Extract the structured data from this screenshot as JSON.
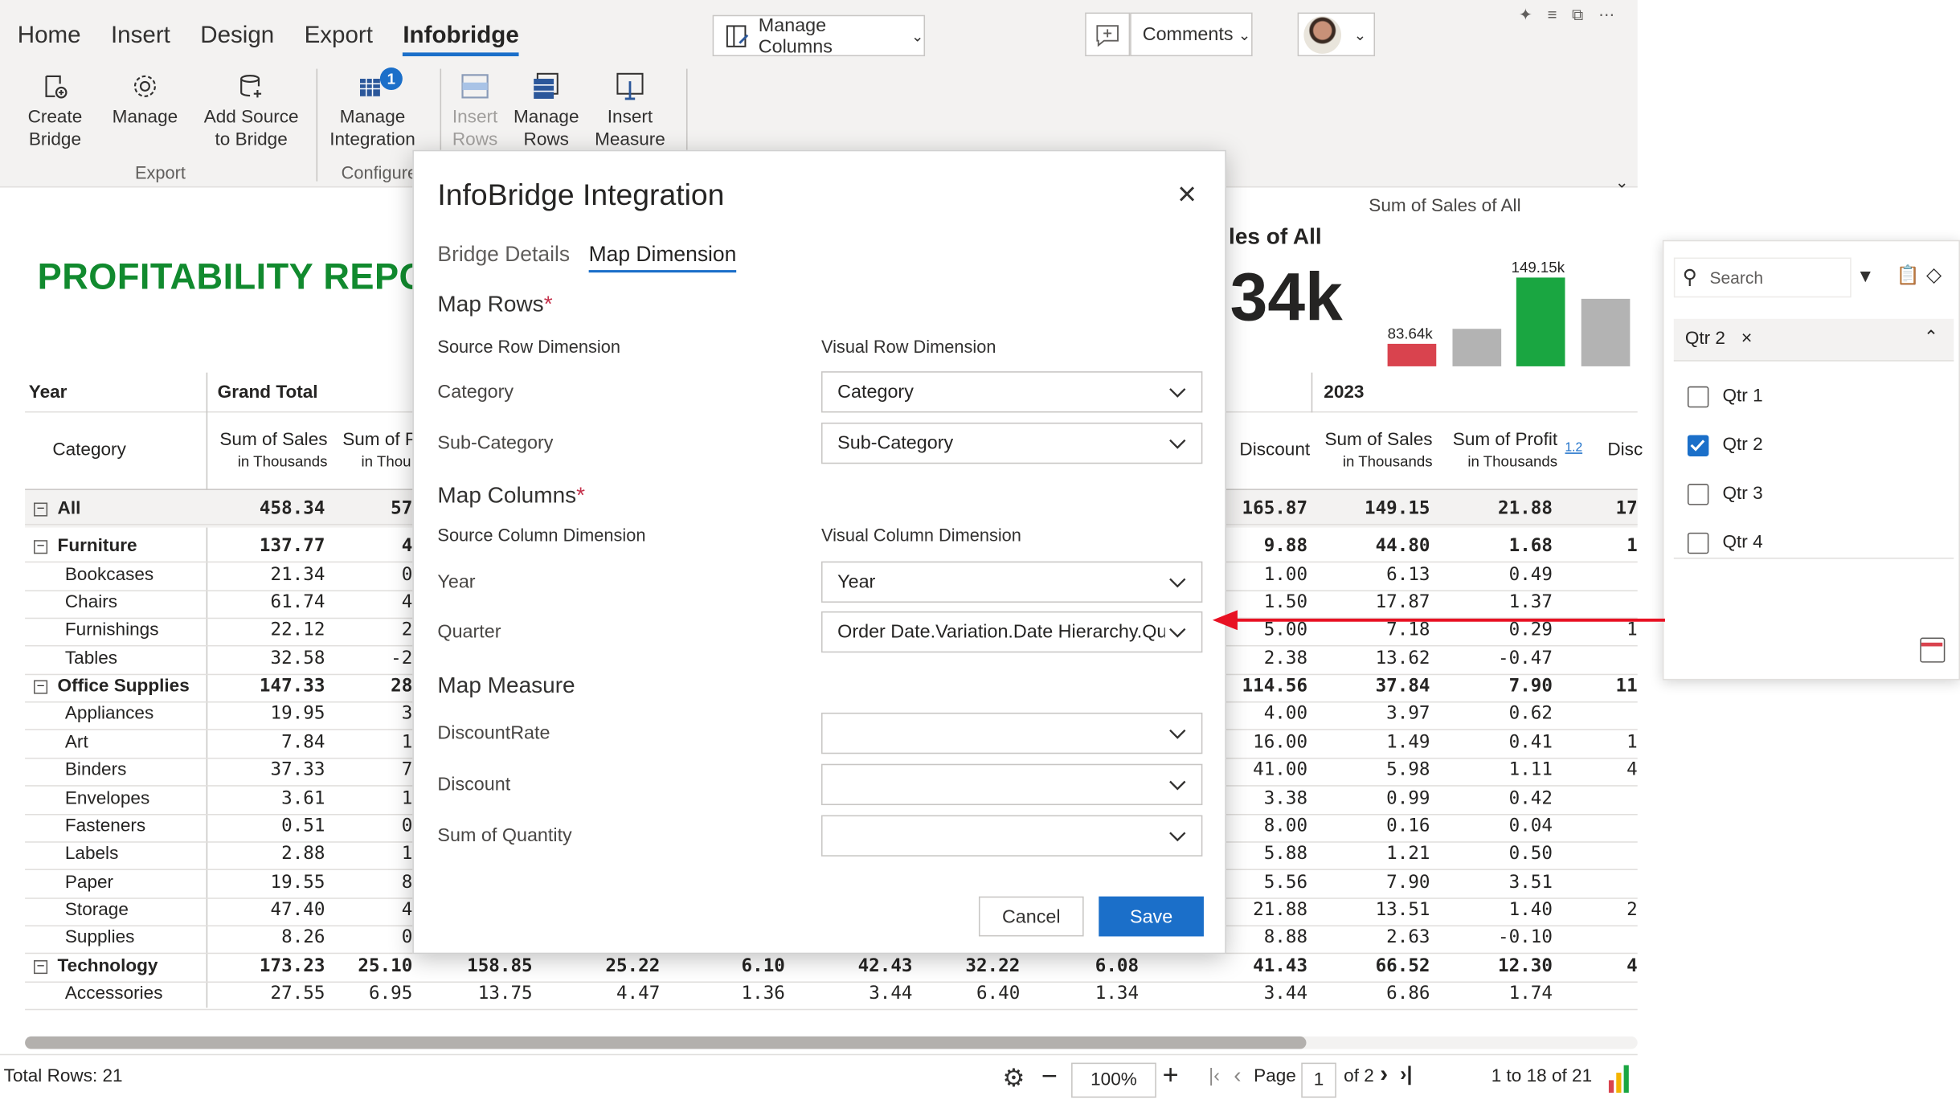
{
  "ribbon": {
    "tabs": [
      "Home",
      "Insert",
      "Design",
      "Export",
      "Infobridge"
    ],
    "buttons": {
      "create_bridge": [
        "Create",
        "Bridge"
      ],
      "manage": "Manage",
      "add_source": [
        "Add Source",
        "to Bridge"
      ],
      "manage_integration": [
        "Manage",
        "Integration"
      ],
      "manage_integration_badge": "1",
      "insert_rows": [
        "Insert",
        "Rows"
      ],
      "manage_rows": [
        "Manage",
        "Rows"
      ],
      "insert_measure": [
        "Insert",
        "Measure"
      ]
    },
    "groups": {
      "export": "Export",
      "configure": "Configure"
    },
    "manage_columns": "Manage Columns",
    "comments": "Comments"
  },
  "report": {
    "title": "PROFITABILITY REPORT",
    "kpi_caption": "Sum of Sales of All",
    "kpi_subtitle": "les of All",
    "kpi_value": "34k",
    "kpi_bar_labels": [
      "83.64k",
      "149.15k"
    ]
  },
  "table": {
    "year_header": "Year",
    "grand_total_header": "Grand Total",
    "year_2023": "2023",
    "category_header": "Category",
    "col_sum_sales": "Sum of Sales",
    "col_in_thousands": "in Thousands",
    "col_sum_profit": "Sum of Profit",
    "col_sum_p_trunc": "Sum of P",
    "col_in_thou_trunc": "in Thou",
    "col_discount": "Discount",
    "col_disc_trunc": "Disc",
    "col_badge": "1.2",
    "rows": [
      {
        "label": "All",
        "bold": true,
        "expand": true,
        "gt_sales": "458.34",
        "gt_p": "57",
        "disc": "165.87",
        "s23": "149.15",
        "p23": "21.88",
        "d23": "17"
      },
      {
        "label": "Furniture",
        "bold": true,
        "expand": true,
        "gt_sales": "137.77",
        "gt_p": "4",
        "disc": "9.88",
        "s23": "44.80",
        "p23": "1.68",
        "d23": "1"
      },
      {
        "label": "Bookcases",
        "gt_sales": "21.34",
        "gt_p": "0",
        "disc": "1.00",
        "s23": "6.13",
        "p23": "0.49",
        "d23": ""
      },
      {
        "label": "Chairs",
        "gt_sales": "61.74",
        "gt_p": "4",
        "disc": "1.50",
        "s23": "17.87",
        "p23": "1.37",
        "d23": ""
      },
      {
        "label": "Furnishings",
        "gt_sales": "22.12",
        "gt_p": "2",
        "disc": "5.00",
        "s23": "7.18",
        "p23": "0.29",
        "d23": "1"
      },
      {
        "label": "Tables",
        "gt_sales": "32.58",
        "gt_p": "-2",
        "disc": "2.38",
        "s23": "13.62",
        "p23": "-0.47",
        "d23": ""
      },
      {
        "label": "Office Supplies",
        "bold": true,
        "expand": true,
        "gt_sales": "147.33",
        "gt_p": "28",
        "disc": "114.56",
        "s23": "37.84",
        "p23": "7.90",
        "d23": "11"
      },
      {
        "label": "Appliances",
        "gt_sales": "19.95",
        "gt_p": "3",
        "disc": "4.00",
        "s23": "3.97",
        "p23": "0.62",
        "d23": ""
      },
      {
        "label": "Art",
        "gt_sales": "7.84",
        "gt_p": "1",
        "disc": "16.00",
        "s23": "1.49",
        "p23": "0.41",
        "d23": "1"
      },
      {
        "label": "Binders",
        "gt_sales": "37.33",
        "gt_p": "7",
        "disc": "41.00",
        "s23": "5.98",
        "p23": "1.11",
        "d23": "4"
      },
      {
        "label": "Envelopes",
        "gt_sales": "3.61",
        "gt_p": "1",
        "disc": "3.38",
        "s23": "0.99",
        "p23": "0.42",
        "d23": ""
      },
      {
        "label": "Fasteners",
        "gt_sales": "0.51",
        "gt_p": "0",
        "disc": "8.00",
        "s23": "0.16",
        "p23": "0.04",
        "d23": ""
      },
      {
        "label": "Labels",
        "gt_sales": "2.88",
        "gt_p": "1",
        "disc": "5.88",
        "s23": "1.21",
        "p23": "0.50",
        "d23": ""
      },
      {
        "label": "Paper",
        "gt_sales": "19.55",
        "gt_p": "8",
        "disc": "5.56",
        "s23": "7.90",
        "p23": "3.51",
        "d23": ""
      },
      {
        "label": "Storage",
        "gt_sales": "47.40",
        "gt_p": "4",
        "disc": "21.88",
        "s23": "13.51",
        "p23": "1.40",
        "d23": "2"
      },
      {
        "label": "Supplies",
        "gt_sales": "8.26",
        "gt_p": "0",
        "disc": "8.88",
        "s23": "2.63",
        "p23": "-0.10",
        "d23": ""
      },
      {
        "label": "Technology",
        "bold": true,
        "expand": true,
        "gt_sales": "173.23",
        "gt_p": "25.10",
        "disc": "41.43",
        "s23": "66.52",
        "p23": "12.30",
        "d23": "4"
      },
      {
        "label": "Accessories",
        "gt_sales": "27.55",
        "gt_p": "6.95",
        "disc": "3.44",
        "s23": "6.86",
        "p23": "1.74",
        "d23": ""
      }
    ],
    "tech_extra": [
      "158.85",
      "25.22",
      "6.10",
      "42.43",
      "32.22",
      "6.08"
    ],
    "acc_extra": [
      "13.75",
      "4.47",
      "1.36",
      "3.44",
      "6.40",
      "1.34"
    ]
  },
  "modal": {
    "title": "InfoBridge Integration",
    "tabs": [
      "Bridge Details",
      "Map Dimension"
    ],
    "map_rows": "Map Rows",
    "source_row_dim": "Source Row Dimension",
    "visual_row_dim": "Visual Row Dimension",
    "row_maps": [
      {
        "source": "Category",
        "visual": "Category"
      },
      {
        "source": "Sub-Category",
        "visual": "Sub-Category"
      }
    ],
    "map_columns": "Map Columns",
    "source_col_dim": "Source Column Dimension",
    "visual_col_dim": "Visual Column Dimension",
    "col_maps": [
      {
        "source": "Year",
        "visual": "Year"
      },
      {
        "source": "Quarter",
        "visual": "Order Date.Variation.Date Hierarchy.Qu"
      }
    ],
    "map_measure": "Map Measure",
    "measures": [
      {
        "source": "DiscountRate",
        "visual": ""
      },
      {
        "source": "Discount",
        "visual": ""
      },
      {
        "source": "Sum of Quantity",
        "visual": ""
      }
    ],
    "required_mark": "*",
    "cancel": "Cancel",
    "save": "Save"
  },
  "slicer": {
    "search_placeholder": "Search",
    "selected_chip": "Qtr 2",
    "items": [
      {
        "label": "Qtr 1",
        "checked": false
      },
      {
        "label": "Qtr 2",
        "checked": true
      },
      {
        "label": "Qtr 3",
        "checked": false
      },
      {
        "label": "Qtr 4",
        "checked": false
      }
    ]
  },
  "status": {
    "total_rows": "Total Rows: 21",
    "zoom": "100%",
    "page_label": "Page",
    "page_value": "1",
    "page_of": "of 2",
    "range": "1 to 18 of 21"
  },
  "colors": {
    "accent": "#1b6fc9",
    "title_green": "#118a2e",
    "highlight_red": "#e81123",
    "bar_red": "#d9434e",
    "bar_green": "#1aa641",
    "bar_grey": "#b3b3b3"
  }
}
